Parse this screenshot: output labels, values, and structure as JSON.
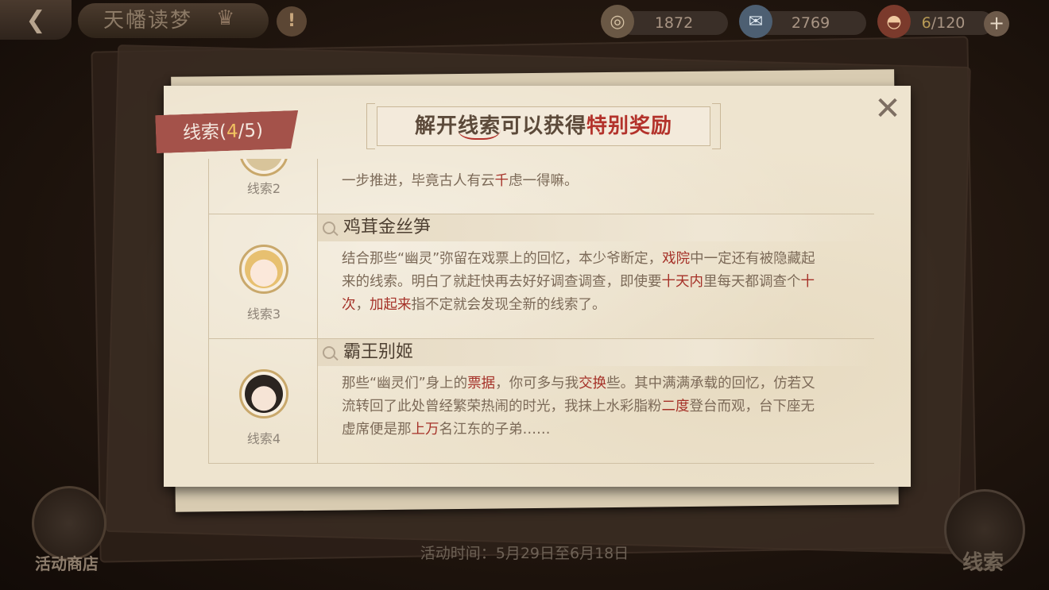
{
  "topbar": {
    "back_icon": "back-arrow-icon",
    "title": "天幡读梦",
    "resources": [
      {
        "icon": "compass-coin-icon",
        "value": "1872"
      },
      {
        "icon": "ticket-icon",
        "value": "2769"
      },
      {
        "icon": "food-bowl-icon",
        "value_current": "6",
        "value_max": "/120"
      }
    ],
    "plus_label": "+"
  },
  "panel": {
    "header": {
      "pre": "解开",
      "mid": "线索",
      "mid2": "可以获得",
      "hl": "特别奖励"
    },
    "clue_tag": {
      "prefix": "线索(",
      "current": "4",
      "suffix": "/5)"
    },
    "close_label": "✕"
  },
  "clues": [
    {
      "label": "线索2",
      "partial_text": [
        {
          "t": "一步推进，毕竟古人有云"
        },
        {
          "t": "千",
          "r": true
        },
        {
          "t": "虑一得嘛。"
        }
      ]
    },
    {
      "label": "线索3",
      "title": "鸡茸金丝笋",
      "body": [
        {
          "t": "结合那些“幽灵”弥留在戏票上的回忆，本少爷断定，"
        },
        {
          "t": "戏院",
          "r": true
        },
        {
          "t": "中一定还有被隐藏起来的线索。明白了就赶快再去好好调查调查，即使要"
        },
        {
          "t": "十天内",
          "r": true
        },
        {
          "t": "里每天都调查个"
        },
        {
          "t": "十次",
          "r": true
        },
        {
          "t": "，"
        },
        {
          "t": "加起来",
          "r": true
        },
        {
          "t": "指不定就会发现全新的线索了。"
        }
      ]
    },
    {
      "label": "线索4",
      "title": "霸王别姬",
      "body": [
        {
          "t": "那些“幽灵们”身上的"
        },
        {
          "t": "票据",
          "r": true
        },
        {
          "t": "，你可多与我"
        },
        {
          "t": "交换",
          "r": true
        },
        {
          "t": "些。其中满满承载的回忆，仿若又流转回了此处曾经繁荣热闹的时光，我抹上水彩脂粉"
        },
        {
          "t": "二度",
          "r": true
        },
        {
          "t": "登台而观，台下座无虚席便是那"
        },
        {
          "t": "上万",
          "r": true
        },
        {
          "t": "名江东的子弟……"
        }
      ]
    }
  ],
  "bottom": {
    "shop_label": "活动商店",
    "event_time": "活动时间：5月29日至6月18日",
    "clue_button_label": "线索"
  },
  "colors": {
    "highlight": "#a53128",
    "tag": "#a4524a",
    "tag_number": "#f1c260"
  }
}
